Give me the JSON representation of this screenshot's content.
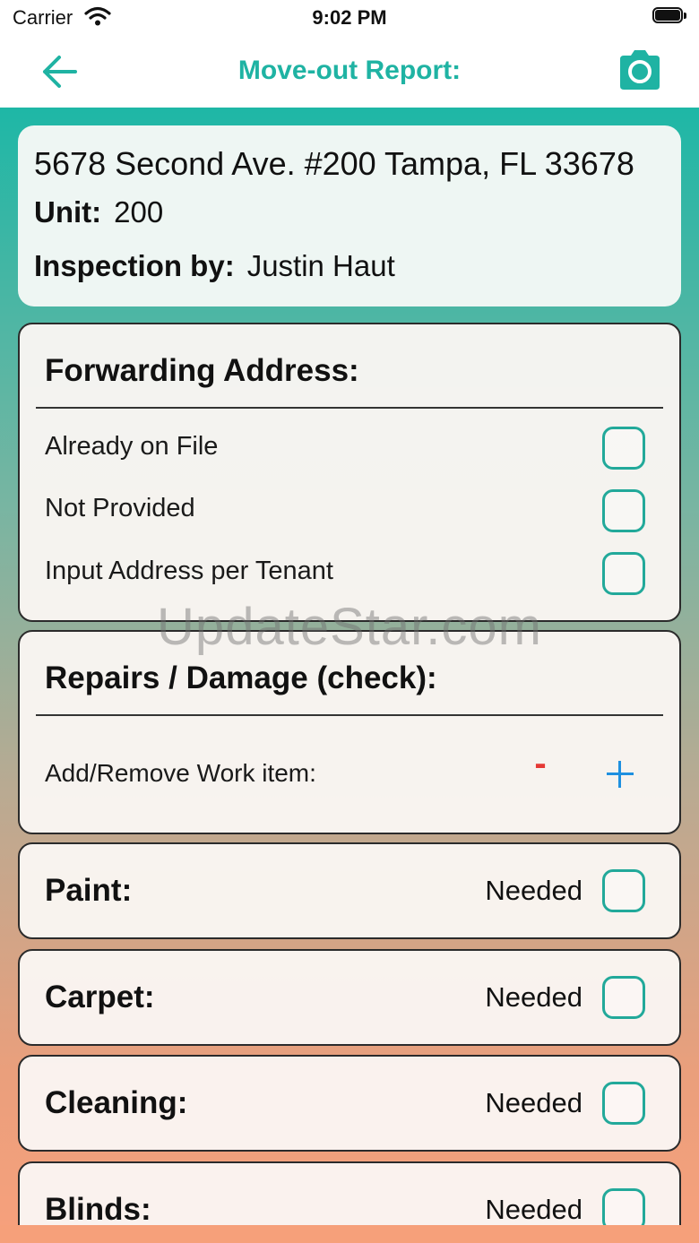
{
  "status_bar": {
    "carrier": "Carrier",
    "time": "9:02 PM"
  },
  "nav": {
    "title": "Move-out Report:",
    "back_icon": "arrow-left-icon",
    "camera_icon": "camera-icon",
    "accent_color": "#1fb3a3"
  },
  "property": {
    "address": "5678 Second Ave. #200 Tampa, FL 33678",
    "unit_label": "Unit:",
    "unit_value": "200",
    "inspector_label": "Inspection by:",
    "inspector_value": "Justin Haut"
  },
  "forwarding": {
    "title": "Forwarding Address:",
    "options": [
      {
        "label": "Already on File",
        "checked": false
      },
      {
        "label": "Not Provided",
        "checked": false
      },
      {
        "label": "Input Address per Tenant",
        "checked": false
      }
    ]
  },
  "repairs": {
    "title": "Repairs / Damage (check):",
    "work_item_label": "Add/Remove Work item:",
    "minus_label": "-",
    "minus_color": "#e53935",
    "plus_color": "#1e90e0"
  },
  "items": [
    {
      "title": "Paint:",
      "status": "Needed",
      "checked": false
    },
    {
      "title": "Carpet:",
      "status": "Needed",
      "checked": false
    },
    {
      "title": "Cleaning:",
      "status": "Needed",
      "checked": false
    },
    {
      "title": "Blinds:",
      "status": "Needed",
      "checked": false
    }
  ],
  "watermark": "UpdateStar.com"
}
